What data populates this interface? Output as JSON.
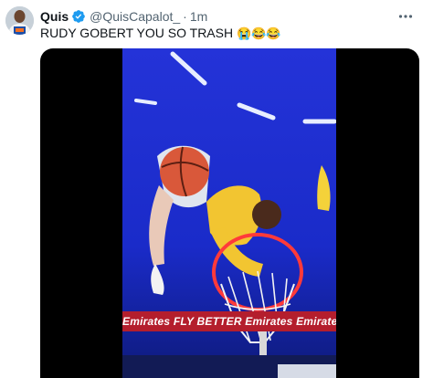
{
  "tweet": {
    "display_name": "Quis",
    "handle": "@QuisCapalot_",
    "separator": "·",
    "time": "1m",
    "text": "RUDY GOBERT YOU SO TRASH",
    "emojis": "😭😂😂"
  },
  "icons": {
    "verified": "verified-badge-icon",
    "more": "more-options-icon"
  },
  "video": {
    "banner_text": "Emirates  FLY BETTER  Emirates  Emirates"
  },
  "colors": {
    "verified_blue": "#1d9bf0",
    "text_primary": "#0f1419",
    "text_secondary": "#536471",
    "court_blue": "#1c30d4"
  }
}
